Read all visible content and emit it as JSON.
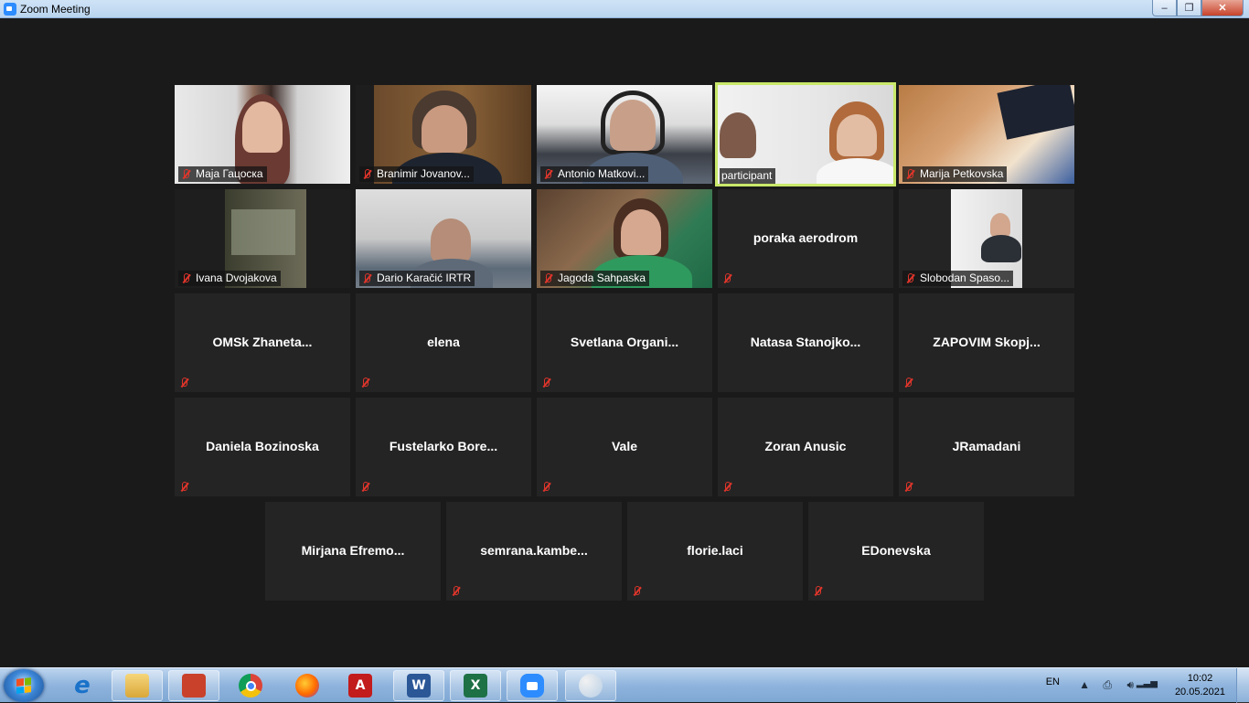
{
  "window": {
    "title": "Zoom Meeting",
    "min": "–",
    "max": "❐",
    "close": "✕"
  },
  "video_tiles": [
    {
      "name": "Маја Гацоска"
    },
    {
      "name": "Branimir Jovanov..."
    },
    {
      "name": "Antonio Matkovi..."
    },
    {
      "name": "participant"
    },
    {
      "name": "Marija Petkovska"
    },
    {
      "name": "Ivana Dvojakova"
    },
    {
      "name": "Dario Karačić IRTR"
    },
    {
      "name": "Jagoda Sahpaska"
    },
    {
      "name": "Slobodan Spaso..."
    }
  ],
  "name_tiles": [
    "poraka aerodrom",
    "OMSk  Zhaneta...",
    "elena",
    "Svetlana  Organi...",
    "Natasa  Stanojko...",
    "ZAPOVIM  Skopj...",
    "Daniela Bozinoska",
    "Fustelarko  Bore...",
    "Vale",
    "Zoran Anusic",
    "JRamadani",
    "Mirjana  Efremo...",
    "semrana.kambe...",
    "florie.laci",
    "EDonevska"
  ],
  "taskbar": {
    "apps": [
      "internet-explorer",
      "file-explorer",
      "presentation-app",
      "chrome",
      "firefox",
      "acrobat",
      "word",
      "excel",
      "zoom",
      "paint"
    ],
    "icon_letters": {
      "ie": "e",
      "word": "W",
      "excel": "X",
      "acrobat": "A"
    },
    "language": "EN",
    "time": "10:02",
    "date": "20.05.2021"
  }
}
